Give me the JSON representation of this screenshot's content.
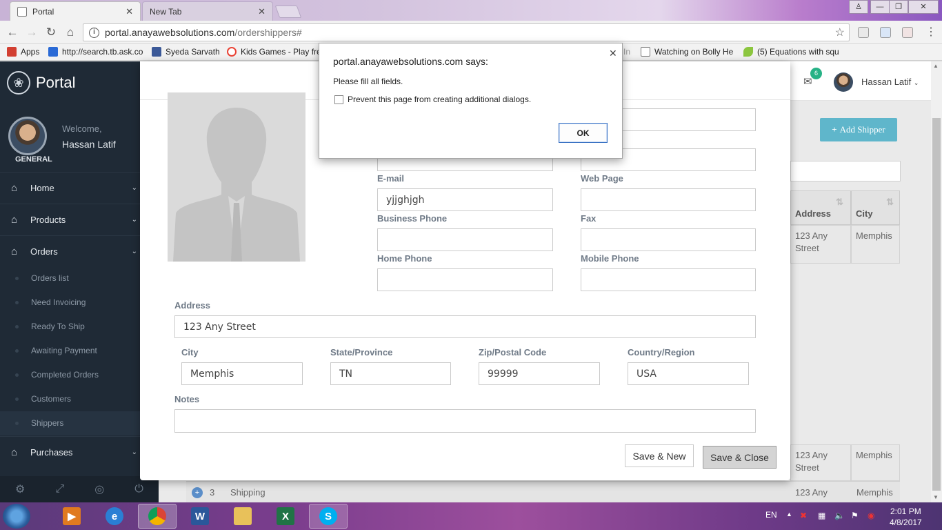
{
  "browser": {
    "tabs": [
      {
        "label": "Portal",
        "active": true
      },
      {
        "label": "New Tab",
        "active": false
      }
    ],
    "url_domain": "portal.anayawebsolutions.com",
    "url_path": "/ordershippers#",
    "bookmarks": [
      {
        "label": "Apps",
        "color": "#d23f31"
      },
      {
        "label": "http://search.tb.ask.co",
        "color": "#2a6ad6"
      },
      {
        "label": "Syeda Sarvath",
        "color": "#3b5998"
      },
      {
        "label": "Kids Games - Play free",
        "color": "#ea4335"
      },
      {
        "label": "Watching on Bolly He",
        "color": "#777777"
      },
      {
        "label": "(5) Equations with squ",
        "color": "#8cc63f"
      }
    ],
    "bookmark_partial": "In"
  },
  "sidebar": {
    "brand": "Portal",
    "welcome": "Welcome,",
    "username": "Hassan Latif",
    "role": "GENERAL",
    "main_items": [
      {
        "label": "Home",
        "icon": "home-icon"
      },
      {
        "label": "Products",
        "icon": "home-icon"
      },
      {
        "label": "Orders",
        "icon": "home-icon"
      },
      {
        "label": "Purchases",
        "icon": "home-icon"
      }
    ],
    "order_subitems": [
      "Orders list",
      "Need Invoicing",
      "Ready To Ship",
      "Awaiting Payment",
      "Completed Orders",
      "Customers",
      "Shippers"
    ]
  },
  "topbar": {
    "mail_count": "6",
    "username": "Hassan Latif"
  },
  "background": {
    "add_button": "Add Shipper",
    "columns": [
      "Address",
      "City"
    ],
    "rows": [
      {
        "address": "123 Any Street",
        "city": "Memphis"
      },
      {
        "address": "123 Any Street",
        "city": "Memphis"
      },
      {
        "address": "123 Any",
        "city": "Memphis"
      }
    ],
    "row3_num": "3",
    "row3_company": "Shipping"
  },
  "form": {
    "partial_label": "e",
    "email_label": "E-mail",
    "email_value": "yjjghjgh",
    "webpage_label": "Web Page",
    "business_phone_label": "Business Phone",
    "fax_label": "Fax",
    "home_phone_label": "Home Phone",
    "mobile_phone_label": "Mobile Phone",
    "address_label": "Address",
    "address_value": "123 Any Street",
    "city_label": "City",
    "city_value": "Memphis",
    "state_label": "State/Province",
    "state_value": "TN",
    "zip_label": "Zip/Postal Code",
    "zip_value": "99999",
    "country_label": "Country/Region",
    "country_value": "USA",
    "notes_label": "Notes",
    "save_new": "Save & New",
    "save_close": "Save & Close"
  },
  "alert": {
    "title": "portal.anayawebsolutions.com says:",
    "message": "Please fill all fields.",
    "checkbox_label": "Prevent this page from creating additional dialogs.",
    "ok": "OK"
  },
  "taskbar": {
    "language": "EN",
    "time": "2:01 PM",
    "date": "4/8/2017"
  }
}
